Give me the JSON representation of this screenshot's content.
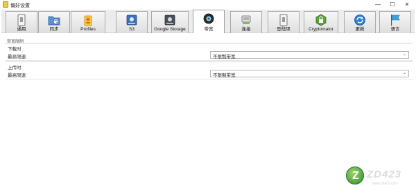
{
  "window": {
    "title": "偏好设置",
    "minimize_glyph": "—",
    "maximize_glyph": "☐",
    "close_glyph": "✕"
  },
  "tabs": [
    {
      "key": "general",
      "label": "通用",
      "icon": "switch-icon",
      "active": false
    },
    {
      "key": "sync",
      "label": "同步",
      "icon": "sync-folder-icon",
      "active": false
    },
    {
      "key": "profiles",
      "label": "Profiles",
      "icon": "profiles-icon",
      "active": false
    },
    {
      "key": "s3",
      "label": "S3",
      "icon": "s3-disk-icon",
      "active": false
    },
    {
      "key": "google-storage",
      "label": "Google Storage",
      "icon": "google-storage-icon",
      "active": false
    },
    {
      "key": "bandwidth",
      "label": "带宽",
      "icon": "bandwidth-icon",
      "active": true
    },
    {
      "key": "connection",
      "label": "连接",
      "icon": "network-icon",
      "active": false
    },
    {
      "key": "login",
      "label": "登陆项",
      "icon": "login-item-icon",
      "active": false
    },
    {
      "key": "cryptomator",
      "label": "Cryptomator",
      "icon": "cryptomator-icon",
      "active": false
    },
    {
      "key": "update",
      "label": "更新",
      "icon": "update-icon",
      "active": false
    },
    {
      "key": "language",
      "label": "语言",
      "icon": "language-flag-icon",
      "active": false
    }
  ],
  "content": {
    "section_label": "带宽限制",
    "download": {
      "group_title": "下载时",
      "row_label": "最高限速:",
      "selected": "不限制带宽"
    },
    "upload": {
      "group_title": "上传时",
      "row_label": "最高限速:",
      "selected": "不限制带宽"
    }
  },
  "watermark": {
    "badge_letter": "Z",
    "brand": "ZD423",
    "url": "www.zd423.com"
  },
  "colors": {
    "accent": "#2f8a2f",
    "toolbar_bg": "#ececec",
    "tab_border": "#a9a9a9"
  }
}
